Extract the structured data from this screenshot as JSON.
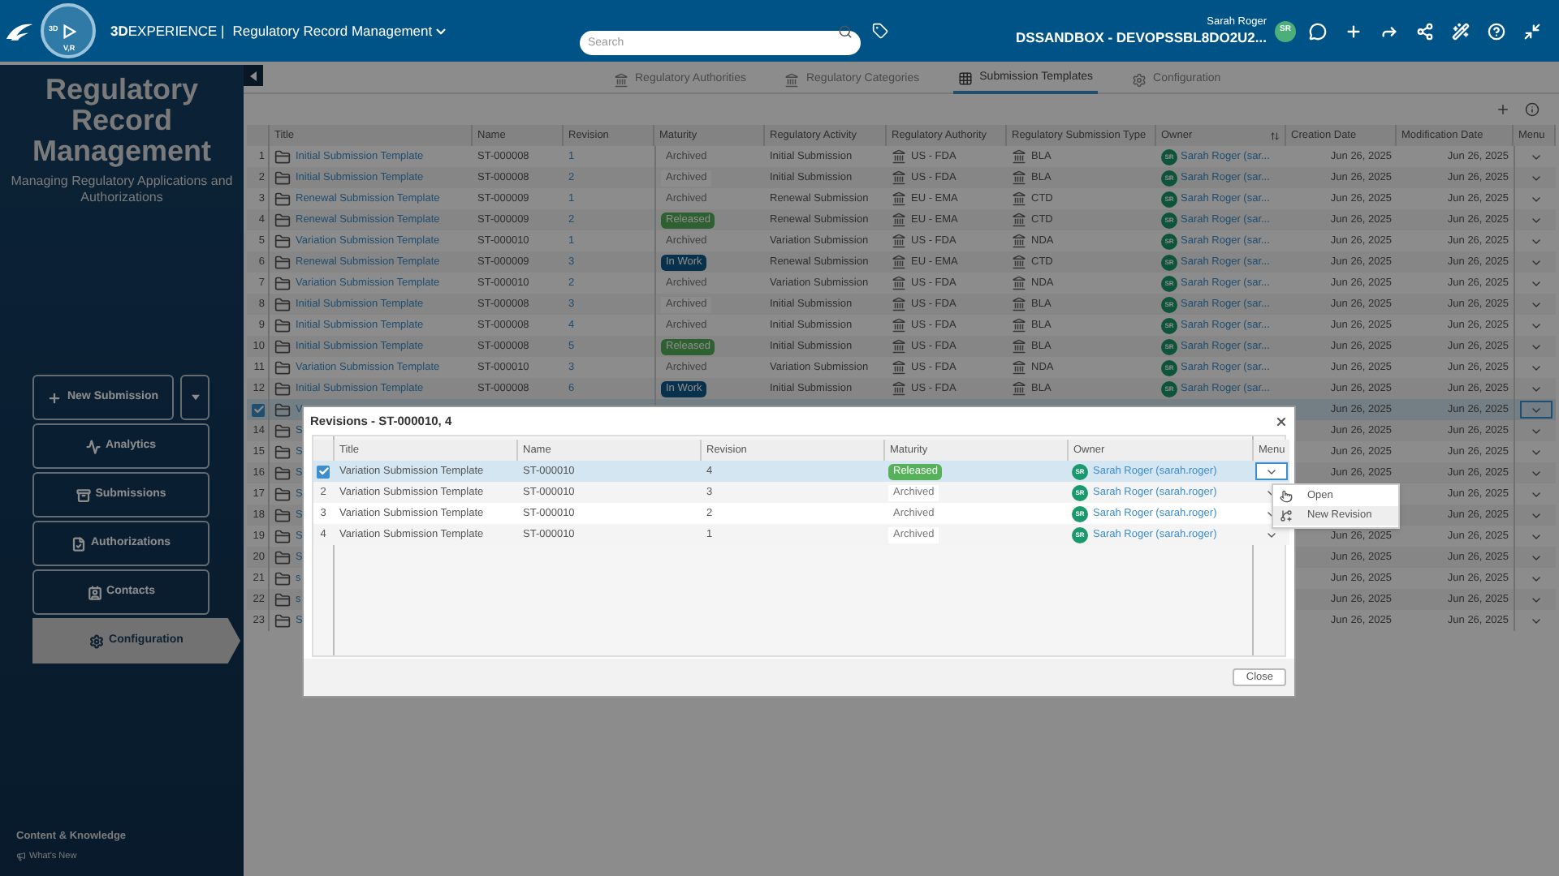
{
  "top_bar": {
    "logo_labels": [
      "3D",
      "V,R"
    ],
    "brand": "**3D**EXPERIENCE |",
    "app_name": "Regulatory Record Management",
    "search": {
      "placeholder": "Search"
    },
    "user_name": "Sarah Roger",
    "tenant": "DSSANDBOX - DEVOPSSBL8DO2U2...",
    "avatar": "SR"
  },
  "sidebar": {
    "title": "Regulatory Record Management",
    "subtitle": "Managing Regulatory Applications and Authorizations",
    "items": [
      {
        "label": "New Submission",
        "kind": "split",
        "selected": false
      },
      {
        "label": "Analytics",
        "kind": "link",
        "selected": false
      },
      {
        "label": "Submissions",
        "kind": "link",
        "selected": false
      },
      {
        "label": "Authorizations",
        "kind": "link",
        "selected": false
      },
      {
        "label": "Contacts",
        "kind": "link",
        "selected": false
      },
      {
        "label": "Configuration",
        "kind": "link",
        "selected": true
      }
    ],
    "footer_title": "Content & Knowledge",
    "footer_link": "What's New"
  },
  "tabs": [
    {
      "label": "Regulatory Authorities",
      "selected": false
    },
    {
      "label": "Regulatory Categories",
      "selected": false
    },
    {
      "label": "Submission Templates",
      "selected": true
    },
    {
      "label": "Configuration",
      "selected": false
    }
  ],
  "table": {
    "columns": [
      "Title",
      "Name",
      "Revision",
      "Maturity",
      "Regulatory Activity",
      "Regulatory Authority",
      "Regulatory Submission Type",
      "Owner",
      "Creation Date",
      "Modification Date",
      "Menu"
    ],
    "rows": [
      {
        "num": "1",
        "selected": false,
        "title": "Initial Submission Template",
        "name": "ST-000008",
        "revision": "1",
        "maturity": {
          "label": "Archived",
          "kind": "archived"
        },
        "activity": "Initial Submission",
        "authority": "US - FDA",
        "type": "BLA",
        "owner": "Sarah Roger (sar...",
        "avatar": "SR",
        "created": "Jun 26, 2025",
        "modified": "Jun 26, 2025"
      },
      {
        "num": "2",
        "selected": false,
        "title": "Initial Submission Template",
        "name": "ST-000008",
        "revision": "2",
        "maturity": {
          "label": "Archived",
          "kind": "archived"
        },
        "activity": "Initial Submission",
        "authority": "US - FDA",
        "type": "BLA",
        "owner": "Sarah Roger (sar...",
        "avatar": "SR",
        "created": "Jun 26, 2025",
        "modified": "Jun 26, 2025"
      },
      {
        "num": "3",
        "selected": false,
        "title": "Renewal Submission Template",
        "name": "ST-000009",
        "revision": "1",
        "maturity": {
          "label": "Archived",
          "kind": "archived"
        },
        "activity": "Renewal Submission",
        "authority": "EU - EMA",
        "type": "CTD",
        "owner": "Sarah Roger (sar...",
        "avatar": "SR",
        "created": "Jun 26, 2025",
        "modified": "Jun 26, 2025"
      },
      {
        "num": "4",
        "selected": false,
        "title": "Renewal Submission Template",
        "name": "ST-000009",
        "revision": "2",
        "maturity": {
          "label": "Released",
          "kind": "released"
        },
        "activity": "Renewal Submission",
        "authority": "EU - EMA",
        "type": "CTD",
        "owner": "Sarah Roger (sar...",
        "avatar": "SR",
        "created": "Jun 26, 2025",
        "modified": "Jun 26, 2025"
      },
      {
        "num": "5",
        "selected": false,
        "title": "Variation Submission Template",
        "name": "ST-000010",
        "revision": "1",
        "maturity": {
          "label": "Archived",
          "kind": "archived"
        },
        "activity": "Variation Submission",
        "authority": "US - FDA",
        "type": "NDA",
        "owner": "Sarah Roger (sar...",
        "avatar": "SR",
        "created": "Jun 26, 2025",
        "modified": "Jun 26, 2025"
      },
      {
        "num": "6",
        "selected": false,
        "title": "Renewal Submission Template",
        "name": "ST-000009",
        "revision": "3",
        "maturity": {
          "label": "In Work",
          "kind": "in_work"
        },
        "activity": "Renewal Submission",
        "authority": "EU - EMA",
        "type": "CTD",
        "owner": "Sarah Roger (sar...",
        "avatar": "SR",
        "created": "Jun 26, 2025",
        "modified": "Jun 26, 2025"
      },
      {
        "num": "7",
        "selected": false,
        "title": "Variation Submission Template",
        "name": "ST-000010",
        "revision": "2",
        "maturity": {
          "label": "Archived",
          "kind": "archived"
        },
        "activity": "Variation Submission",
        "authority": "US - FDA",
        "type": "NDA",
        "owner": "Sarah Roger (sar...",
        "avatar": "SR",
        "created": "Jun 26, 2025",
        "modified": "Jun 26, 2025"
      },
      {
        "num": "8",
        "selected": false,
        "title": "Initial Submission Template",
        "name": "ST-000008",
        "revision": "3",
        "maturity": {
          "label": "Archived",
          "kind": "archived"
        },
        "activity": "Initial Submission",
        "authority": "US - FDA",
        "type": "BLA",
        "owner": "Sarah Roger (sar...",
        "avatar": "SR",
        "created": "Jun 26, 2025",
        "modified": "Jun 26, 2025"
      },
      {
        "num": "9",
        "selected": false,
        "title": "Initial Submission Template",
        "name": "ST-000008",
        "revision": "4",
        "maturity": {
          "label": "Archived",
          "kind": "archived"
        },
        "activity": "Initial Submission",
        "authority": "US - FDA",
        "type": "BLA",
        "owner": "Sarah Roger (sar...",
        "avatar": "SR",
        "created": "Jun 26, 2025",
        "modified": "Jun 26, 2025"
      },
      {
        "num": "10",
        "selected": false,
        "title": "Initial Submission Template",
        "name": "ST-000008",
        "revision": "5",
        "maturity": {
          "label": "Released",
          "kind": "released"
        },
        "activity": "Initial Submission",
        "authority": "US - FDA",
        "type": "BLA",
        "owner": "Sarah Roger (sar...",
        "avatar": "SR",
        "created": "Jun 26, 2025",
        "modified": "Jun 26, 2025"
      },
      {
        "num": "11",
        "selected": false,
        "title": "Variation Submission Template",
        "name": "ST-000010",
        "revision": "3",
        "maturity": {
          "label": "Archived",
          "kind": "archived"
        },
        "activity": "Variation Submission",
        "authority": "US - FDA",
        "type": "NDA",
        "owner": "Sarah Roger (sar...",
        "avatar": "SR",
        "created": "Jun 26, 2025",
        "modified": "Jun 26, 2025"
      },
      {
        "num": "12",
        "selected": false,
        "title": "Initial Submission Template",
        "name": "ST-000008",
        "revision": "6",
        "maturity": {
          "label": "In Work",
          "kind": "in_work"
        },
        "activity": "Initial Submission",
        "authority": "US - FDA",
        "type": "BLA",
        "owner": "Sarah Roger (sar...",
        "avatar": "SR",
        "created": "Jun 26, 2025",
        "modified": "Jun 26, 2025"
      },
      {
        "selected": true,
        "title": "V",
        "created": "Jun 26, 2025",
        "modified": "Jun 26, 2025"
      },
      {
        "num": "14",
        "selected": false,
        "title": "S",
        "created": "Jun 26, 2025",
        "modified": "Jun 26, 2025"
      },
      {
        "num": "15",
        "selected": false,
        "title": "S",
        "created": "Jun 26, 2025",
        "modified": "Jun 26, 2025"
      },
      {
        "num": "16",
        "selected": false,
        "title": "S",
        "created": "Jun 26, 2025",
        "modified": "Jun 26, 2025"
      },
      {
        "num": "17",
        "selected": false,
        "title": "S",
        "modified": "Jun 26, 2025"
      },
      {
        "num": "18",
        "selected": false,
        "title": "S",
        "modified": "Jun 26, 2025"
      },
      {
        "num": "19",
        "selected": false,
        "title": "S",
        "created": "Jun 26, 2025",
        "modified": "Jun 26, 2025"
      },
      {
        "num": "20",
        "selected": false,
        "title": "S",
        "created": "Jun 26, 2025",
        "modified": "Jun 26, 2025"
      },
      {
        "num": "21",
        "selected": false,
        "title": "s",
        "created": "Jun 26, 2025",
        "modified": "Jun 26, 2025"
      },
      {
        "num": "22",
        "selected": false,
        "title": "s",
        "created": "Jun 26, 2025",
        "modified": "Jun 26, 2025"
      },
      {
        "num": "23",
        "selected": false,
        "title": "S",
        "created": "Jun 26, 2025",
        "modified": "Jun 26, 2025"
      }
    ]
  },
  "dialog": {
    "title": "Revisions - ST-000010, 4",
    "columns": [
      "Title",
      "Name",
      "Revision",
      "Maturity",
      "Owner",
      "Menu"
    ],
    "rows": [
      {
        "selected": true,
        "title": "Variation Submission Template",
        "name": "ST-000010",
        "revision": "4",
        "maturity": {
          "label": "Released",
          "kind": "released"
        },
        "owner": "Sarah Roger (sarah.roger)",
        "avatar": "SR"
      },
      {
        "num": "2",
        "selected": false,
        "title": "Variation Submission Template",
        "name": "ST-000010",
        "revision": "3",
        "maturity": {
          "label": "Archived",
          "kind": "archived"
        },
        "owner": "Sarah Roger (sarah.roger)",
        "avatar": "SR"
      },
      {
        "num": "3",
        "selected": false,
        "title": "Variation Submission Template",
        "name": "ST-000010",
        "revision": "2",
        "maturity": {
          "label": "Archived",
          "kind": "archived"
        },
        "owner": "Sarah Roger (sarah.roger)",
        "avatar": "SR"
      },
      {
        "num": "4",
        "selected": false,
        "title": "Variation Submission Template",
        "name": "ST-000010",
        "revision": "1",
        "maturity": {
          "label": "Archived",
          "kind": "archived"
        },
        "owner": "Sarah Roger (sarah.roger)",
        "avatar": "SR"
      }
    ],
    "menu": [
      {
        "label": "Open",
        "selected": false
      },
      {
        "label": "New Revision",
        "selected": true
      }
    ],
    "close_button": "Close"
  }
}
